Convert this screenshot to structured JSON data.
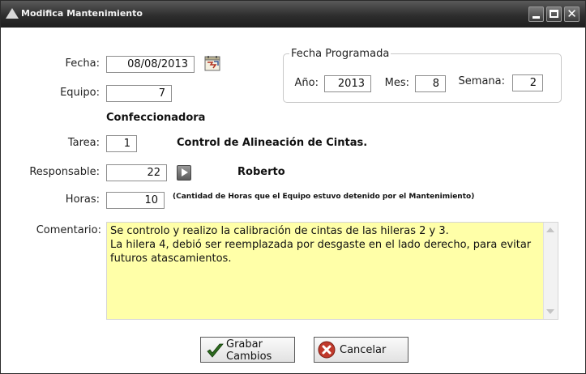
{
  "window": {
    "title": "Modifica Mantenimiento",
    "icons": {
      "logo": "app-logo-icon",
      "minimize": "minimize-icon",
      "maximize": "maximize-icon",
      "close": "close-icon"
    },
    "close_glyph": "✕"
  },
  "form": {
    "fecha": {
      "label": "Fecha:",
      "value": "08/08/2013",
      "icon": "calendar-icon"
    },
    "equipo": {
      "label": "Equipo:",
      "value": "7",
      "name": "Confeccionadora"
    },
    "tarea": {
      "label": "Tarea:",
      "value": "1",
      "name": "Control de Alineación de Cintas."
    },
    "responsable": {
      "label": "Responsable:",
      "value": "22",
      "name": "Roberto",
      "icon": "play-arrow-icon"
    },
    "horas": {
      "label": "Horas:",
      "value": "10",
      "note": "(Cantidad de Horas que el Equipo estuvo detenido por el Mantenimiento)"
    },
    "comentario": {
      "label": "Comentario:",
      "value": "Se controlo y realizo la calibración de cintas de las hileras 2 y 3.\nLa hilera 4, debió ser reemplazada por desgaste en el lado derecho, para evitar futuros atascamientos."
    }
  },
  "fecha_programada": {
    "title": "Fecha Programada",
    "anio": {
      "label": "Año:",
      "value": "2013"
    },
    "mes": {
      "label": "Mes:",
      "value": "8"
    },
    "semana": {
      "label": "Semana:",
      "value": "2"
    }
  },
  "buttons": {
    "grabar": {
      "line1": "Grabar",
      "line2": "Cambios",
      "icon": "checkmark-icon"
    },
    "cancelar": {
      "label": "Cancelar",
      "icon": "cancel-icon"
    }
  },
  "colors": {
    "titlebar": "#2e2e2e",
    "textarea_bg": "#ffffa8",
    "check": "#2d6b1e",
    "cancel_red": "#c0392b"
  }
}
